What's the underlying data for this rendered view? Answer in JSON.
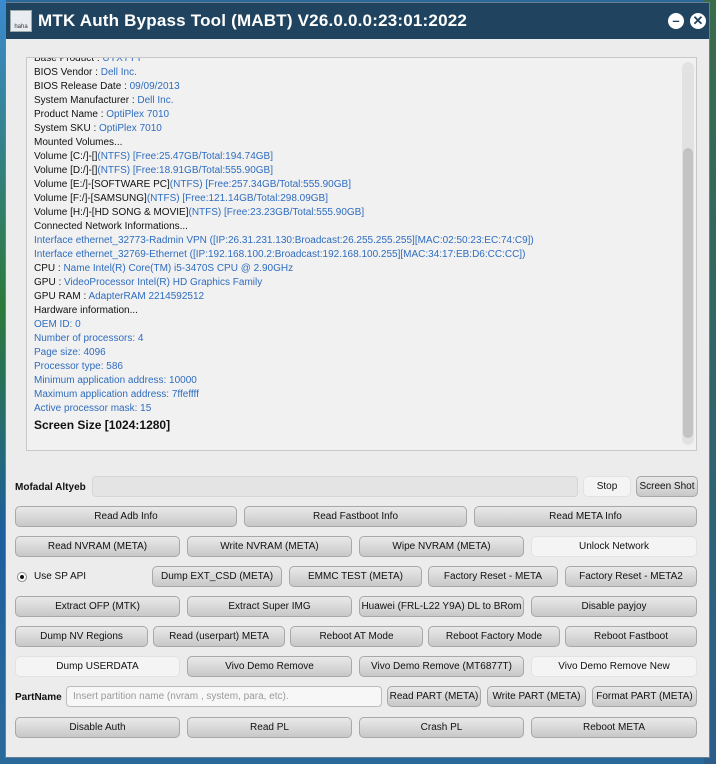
{
  "window": {
    "title": "MTK Auth Bypass Tool (MABT) V26.0.0.0:23:01:2022",
    "icon_text": "haha",
    "minimize_label": "–",
    "close_label": "✕"
  },
  "log": [
    {
      "k": "Base Product : ",
      "v": "UYXTYY"
    },
    {
      "k": "BIOS Vendor : ",
      "v": "Dell Inc."
    },
    {
      "k": "BIOS Release Date : ",
      "v": "09/09/2013"
    },
    {
      "k": "System Manufacturer : ",
      "v": "Dell Inc."
    },
    {
      "k": "Product Name : ",
      "v": "OptiPlex 7010"
    },
    {
      "k": "System SKU : ",
      "v": "OptiPlex 7010"
    },
    {
      "k": "Mounted Volumes...",
      "v": ""
    },
    {
      "k": "Volume [C:/]-[]",
      "v": "(NTFS) [Free:25.47GB/Total:194.74GB]"
    },
    {
      "k": "Volume [D:/]-[]",
      "v": "(NTFS) [Free:18.91GB/Total:555.90GB]"
    },
    {
      "k": "Volume [E:/]-[SOFTWARE PC]",
      "v": "(NTFS) [Free:257.34GB/Total:555.90GB]"
    },
    {
      "k": "Volume [F:/]-[SAMSUNG]",
      "v": "(NTFS) [Free:121.14GB/Total:298.09GB]"
    },
    {
      "k": "Volume [H:/]-[HD SONG & MOVIE]",
      "v": "(NTFS) [Free:23.23GB/Total:555.90GB]"
    },
    {
      "k": "Connected Network Informations...",
      "v": ""
    },
    {
      "k": "",
      "v": "Interface ethernet_32773-Radmin VPN ([IP:26.31.231.130:Broadcast:26.255.255.255][MAC:02:50:23:EC:74:C9])"
    },
    {
      "k": "",
      "v": "Interface ethernet_32769-Ethernet ([IP:192.168.100.2:Broadcast:192.168.100.255][MAC:34:17:EB:D6:CC:CC])"
    },
    {
      "k": "CPU  : ",
      "v": "Name Intel(R) Core(TM) i5-3470S CPU @ 2.90GHz"
    },
    {
      "k": "GPU  : ",
      "v": "VideoProcessor Intel(R) HD Graphics Family"
    },
    {
      "k": "GPU RAM  : ",
      "v": "AdapterRAM 2214592512"
    },
    {
      "k": "Hardware information...",
      "v": ""
    },
    {
      "k": "",
      "v": "OEM ID: 0"
    },
    {
      "k": "",
      "v": "Number of processors: 4"
    },
    {
      "k": "",
      "v": "Page size: 4096"
    },
    {
      "k": "",
      "v": "Processor type: 586"
    },
    {
      "k": "",
      "v": "Minimum application address: 10000"
    },
    {
      "k": "",
      "v": "Maximum application address: 7ffeffff"
    },
    {
      "k": "",
      "v": "Active processor mask: 15"
    }
  ],
  "screen_size": "Screen Size [1024:1280]",
  "status_row": {
    "user_label": "Mofadal Altyeb",
    "stop_label": "Stop",
    "screenshot_label": "Screen Shot"
  },
  "buttons": {
    "read_adb_info": "Read Adb Info",
    "read_fastboot_info": "Read Fastboot Info",
    "read_meta_info": "Read META Info",
    "read_nvram_meta": "Read NVRAM (META)",
    "write_nvram_meta": "Write NVRAM (META)",
    "wipe_nvram_meta": "Wipe NVRAM (META)",
    "unlock_network": "Unlock Network",
    "use_sp_api": "Use SP API",
    "dump_ext_csd": "Dump  EXT_CSD (META)",
    "emmc_test": "EMMC TEST (META)",
    "factory_reset_meta": "Factory Reset - META",
    "factory_reset_meta2": "Factory Reset - META2",
    "extract_ofp": "Extract OFP (MTK)",
    "extract_super_img": "Extract Super IMG",
    "huawei_dl_to_brom": "Huawei (FRL-L22 Y9A) DL to BRom",
    "disable_payjoy": "Disable payjoy",
    "dump_nv_regions": "Dump NV Regions",
    "read_userpart_meta": "Read (userpart) META",
    "reboot_at_mode": "Reboot AT Mode",
    "reboot_factory_mode": "Reboot Factory Mode",
    "reboot_fastboot": "Reboot Fastboot",
    "dump_userdata": "Dump USERDATA",
    "vivo_demo_remove": "Vivo Demo Remove",
    "vivo_demo_remove_mt6877t": "Vivo Demo Remove (MT6877T)",
    "vivo_demo_remove_new": "Vivo Demo Remove New",
    "partname_label": "PartName",
    "partname_placeholder": "Insert partition name (nvram , system, para, etc).",
    "read_part_meta": "Read PART (META)",
    "write_part_meta": "Write PART (META)",
    "format_part_meta": "Format PART (META)",
    "disable_auth": "Disable Auth",
    "read_pl": "Read PL",
    "crash_pl": "Crash PL",
    "reboot_meta": "Reboot META"
  }
}
